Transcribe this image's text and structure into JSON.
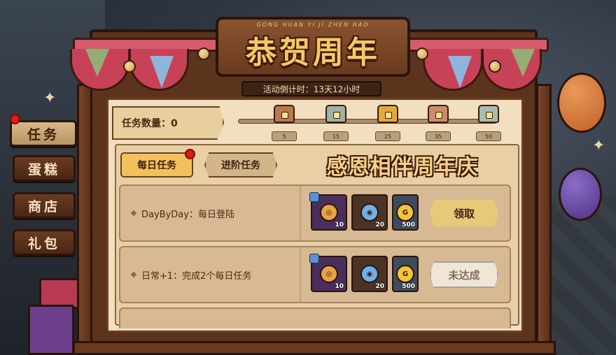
{
  "header": {
    "title_sub": "GONG HUAN YI JI ZHEN HAO",
    "title": "恭贺周年",
    "countdown": "活动倒计时：13天12小时"
  },
  "sidebar": {
    "items": [
      {
        "label": "任务",
        "active": true,
        "notify": true
      },
      {
        "label": "蛋糕",
        "active": false,
        "notify": false
      },
      {
        "label": "商店",
        "active": false,
        "notify": false
      },
      {
        "label": "礼包",
        "active": false,
        "notify": false
      }
    ]
  },
  "task_progress": {
    "count_label": "任务数量：0",
    "current": 0,
    "milestones": [
      "5",
      "15",
      "25",
      "35",
      "50"
    ]
  },
  "tabs": {
    "daily": "每日任务",
    "advanced": "进阶任务"
  },
  "banner": "感恩相伴周年庆",
  "tasks": [
    {
      "name": "DayByDay：每日登陆",
      "rewards": [
        {
          "icon": "token-icon",
          "qty": "10"
        },
        {
          "icon": "blue-coin-icon",
          "qty": "20"
        },
        {
          "icon": "gold-coin-icon",
          "qty": "500"
        }
      ],
      "action": "领取"
    },
    {
      "name": "日常+1：完成2个每日任务",
      "rewards": [
        {
          "icon": "token-icon",
          "qty": "10"
        },
        {
          "icon": "blue-coin-icon",
          "qty": "20"
        },
        {
          "icon": "gold-coin-icon",
          "qty": "500"
        }
      ],
      "action": "未达成"
    }
  ],
  "colors": {
    "wood": "#5c331d",
    "paper": "#f1dfbf",
    "accent_gold": "#f2c15e",
    "notify_red": "#e01818"
  }
}
